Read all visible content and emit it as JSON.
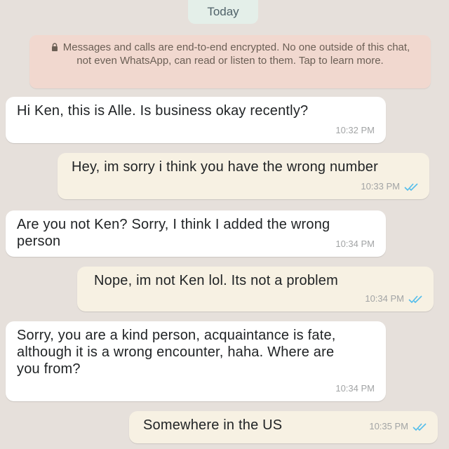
{
  "date_label": "Today",
  "encryption_notice": "Messages and calls are end-to-end encrypted. No one outside of this chat, not even WhatsApp, can read or listen to them. Tap to learn more.",
  "colors": {
    "incoming_bubble": "#ffffff",
    "outgoing_bubble": "#f7f1e3",
    "notice_bg": "#f1d8cf",
    "read_ticks": "#53bdeb"
  },
  "messages": [
    {
      "direction": "in",
      "text": "Hi Ken, this is Alle. Is business okay recently?",
      "time": "10:32 PM"
    },
    {
      "direction": "out",
      "text": "Hey, im sorry i think you have the wrong number",
      "time": "10:33 PM",
      "status": "read"
    },
    {
      "direction": "in",
      "text": "Are you not Ken? Sorry, I think I added the wrong person",
      "time": "10:34 PM"
    },
    {
      "direction": "out",
      "text": "Nope, im not Ken lol. Its not a problem",
      "time": "10:34 PM",
      "status": "read"
    },
    {
      "direction": "in",
      "text": "Sorry, you are a kind person, acquaintance is fate, although it is a wrong encounter, haha. Where are you from?",
      "time": "10:34 PM"
    },
    {
      "direction": "out",
      "text": "Somewhere in the US",
      "time": "10:35 PM",
      "status": "read"
    }
  ]
}
